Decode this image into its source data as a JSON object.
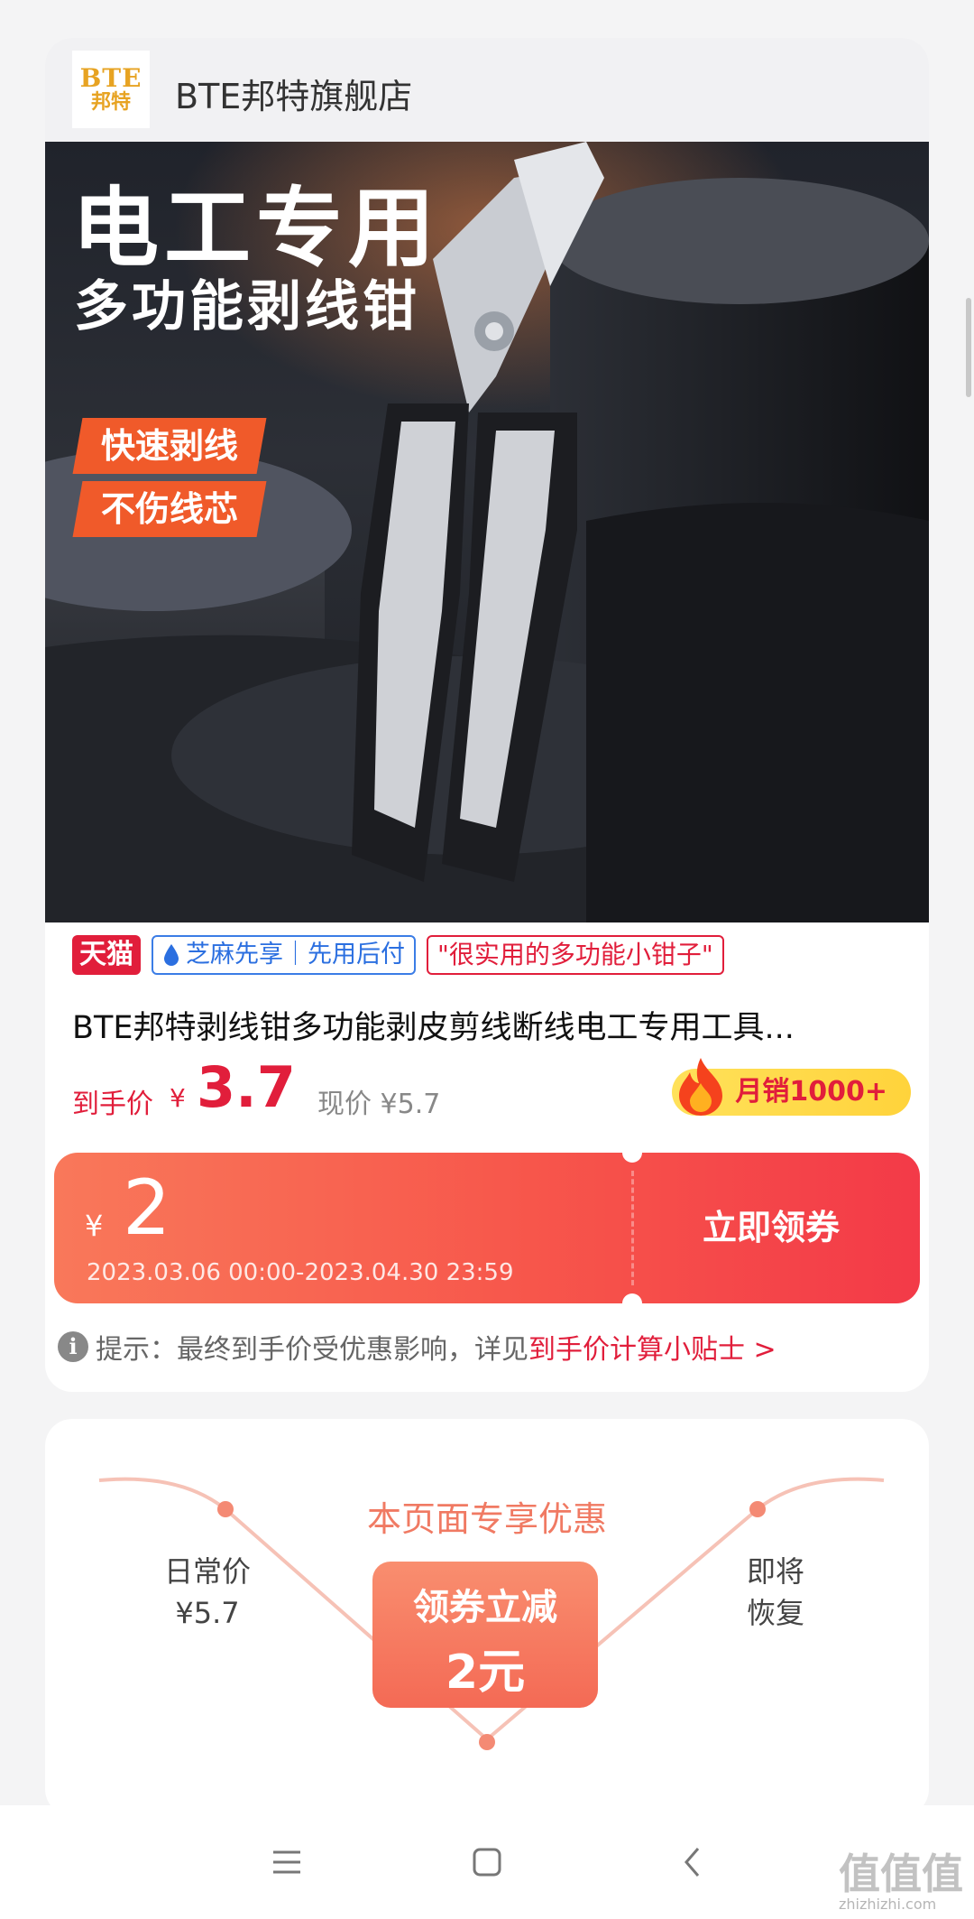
{
  "store": {
    "logo_text": "BTE",
    "logo_subtext": "邦特",
    "name": "BTE邦特旗舰店"
  },
  "banner": {
    "title": "电工专用",
    "subtitle": "多功能剥线钳",
    "tags": [
      "快速剥线",
      "不伤线芯"
    ]
  },
  "badges": {
    "tmall": "天猫",
    "zhima": "芝麻先享｜先用后付",
    "quote": "\"很实用的多功能小钳子\""
  },
  "product": {
    "title": "BTE邦特剥线钳多功能剥皮剪线断线电工专用工具...",
    "final_price_label": "到手价",
    "currency": "¥",
    "final_price": "3.7",
    "current_price": "现价 ¥5.7",
    "monthly_sales": "月销1000+"
  },
  "coupon": {
    "currency": "¥",
    "amount": "2",
    "validity": "2023.03.06 00:00-2023.04.30 23:59",
    "button": "立即领券"
  },
  "tip": {
    "text": "提示：最终到手价受优惠影响，详见",
    "link": "到手价计算小贴士 >"
  },
  "exclusive": {
    "title": "本页面专享优惠",
    "daily_label": "日常价",
    "daily_price": "¥5.7",
    "coupon_line1": "领券立减",
    "coupon_line2": "2元",
    "restore_line1": "即将",
    "restore_line2": "恢复"
  },
  "watermark": {
    "text": "值值值",
    "domain": "zhizhizhi.com"
  },
  "colors": {
    "accent_red": "#e11e3b",
    "coupon_orange": "#f7564b",
    "tmall_red": "#e11e3b",
    "zhima_blue": "#2b6fe0"
  }
}
